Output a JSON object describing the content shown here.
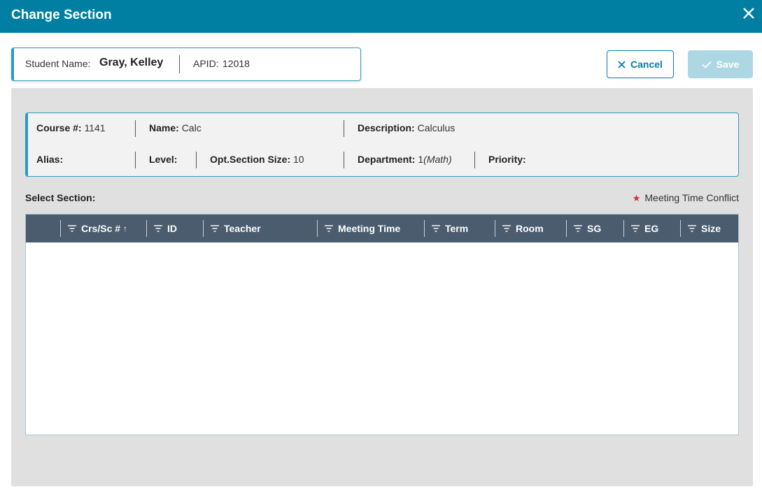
{
  "dialog": {
    "title": "Change Section"
  },
  "student": {
    "name_label": "Student Name:",
    "name": "Gray, Kelley",
    "apid_label": "APID:",
    "apid": "12018"
  },
  "actions": {
    "cancel_label": "Cancel",
    "save_label": "Save"
  },
  "course": {
    "course_no_label": "Course #:",
    "course_no": "1141",
    "name_label": "Name:",
    "name": "Calc",
    "description_label": "Description:",
    "description": "Calculus",
    "alias_label": "Alias:",
    "alias": "",
    "level_label": "Level:",
    "level": "",
    "opt_size_label": "Opt.Section Size:",
    "opt_size": "10",
    "department_label": "Department:",
    "department_num": "1",
    "department_name": "(Math)",
    "priority_label": "Priority:",
    "priority": ""
  },
  "section_select": {
    "label": "Select Section:",
    "legend": "Meeting Time Conflict"
  },
  "grid": {
    "columns": [
      "Crs/Sc #",
      "ID",
      "Teacher",
      "Meeting Time",
      "Term",
      "Room",
      "SG",
      "EG",
      "Size"
    ],
    "sort_indicator": "↑",
    "rows": []
  },
  "colors": {
    "header_bg": "#007fa3",
    "accent": "#2a9cbd",
    "grid_header": "#4a5c6e",
    "conflict_star": "#d92b2b"
  }
}
